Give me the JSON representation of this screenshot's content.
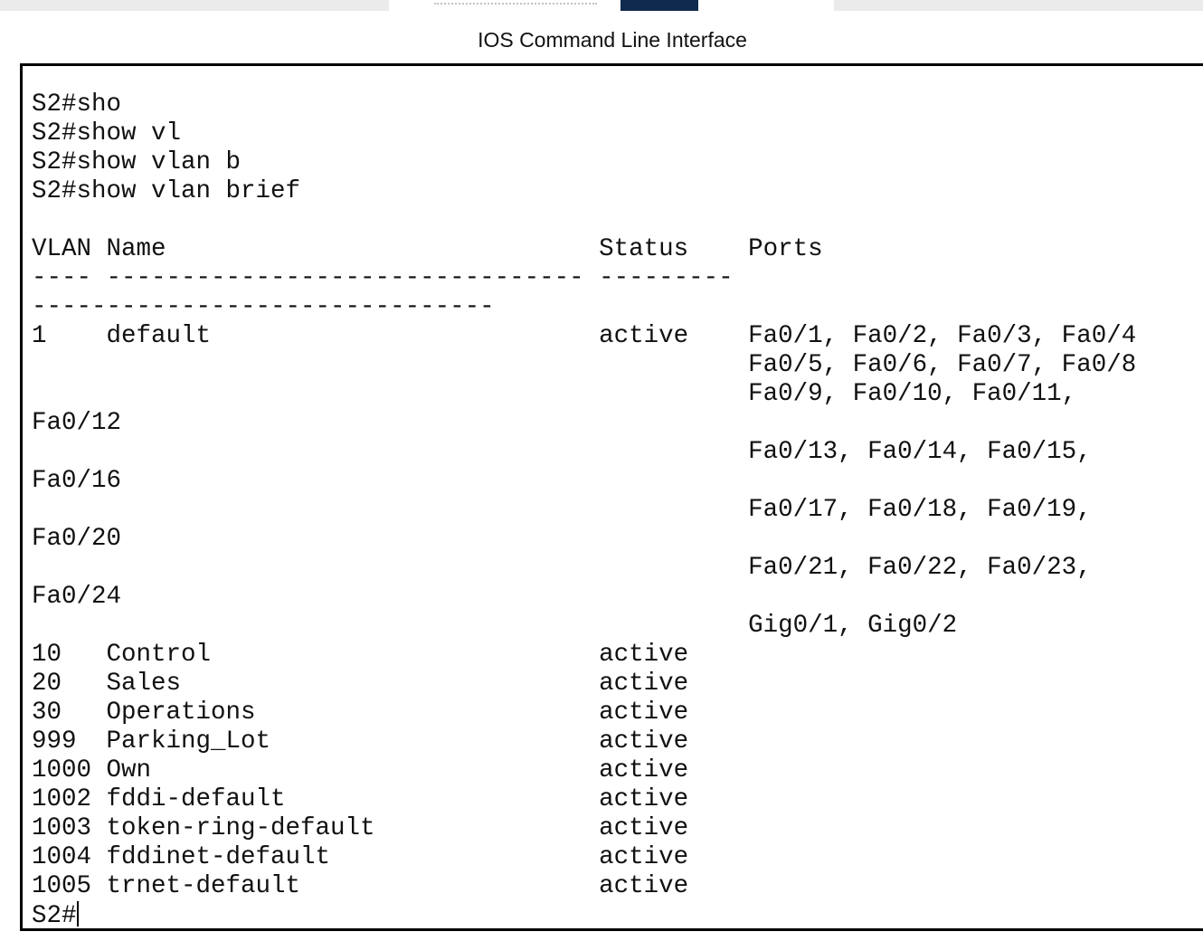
{
  "window": {
    "title": "IOS Command Line Interface"
  },
  "terminal": {
    "output": "S2#sho\nS2#show vl\nS2#show vlan b\nS2#show vlan brief\n\nVLAN Name                             Status    Ports\n---- -------------------------------- ---------\n-------------------------------\n1    default                          active    Fa0/1, Fa0/2, Fa0/3, Fa0/4\n                                                Fa0/5, Fa0/6, Fa0/7, Fa0/8\n                                                Fa0/9, Fa0/10, Fa0/11,\nFa0/12\n                                                Fa0/13, Fa0/14, Fa0/15,\nFa0/16\n                                                Fa0/17, Fa0/18, Fa0/19,\nFa0/20\n                                                Fa0/21, Fa0/22, Fa0/23,\nFa0/24\n                                                Gig0/1, Gig0/2\n10   Control                          active\n20   Sales                            active\n30   Operations                       active\n999  Parking_Lot                      active\n1000 Own                              active\n1002 fddi-default                     active\n1003 token-ring-default               active\n1004 fddinet-default                  active\n1005 trnet-default                    active",
    "prompt": "S2#"
  },
  "colors": {
    "border": "#000000",
    "text": "#111111",
    "active_tab": "#102a4e",
    "tab_strip": "#ebebeb"
  }
}
